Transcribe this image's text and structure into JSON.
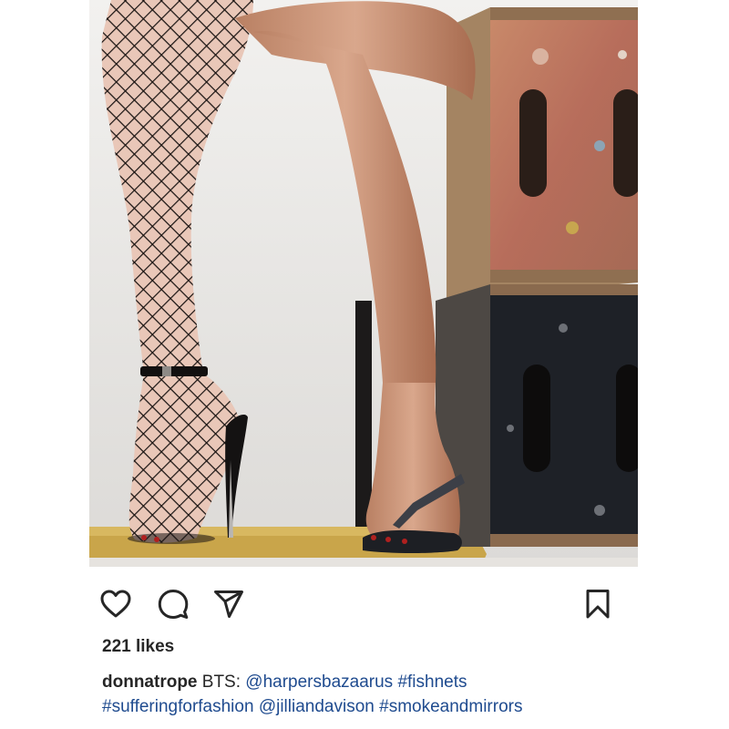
{
  "post": {
    "likes_text": "221 likes",
    "username": "donnatrope",
    "caption_prefix": "BTS:",
    "mentions": {
      "harpers": "@harpersbazaarus",
      "jillian": "@jilliandavison"
    },
    "hashtags": {
      "fishnets": "#fishnets",
      "suffering": "#sufferingforfashion",
      "smoke": "#smokeandmirrors"
    }
  },
  "actions": [
    "heart-icon",
    "comment-icon",
    "share-icon",
    "bookmark-icon"
  ],
  "colors": {
    "text": "#262626",
    "link": "#1f4b8f",
    "background": "#ffffff"
  }
}
